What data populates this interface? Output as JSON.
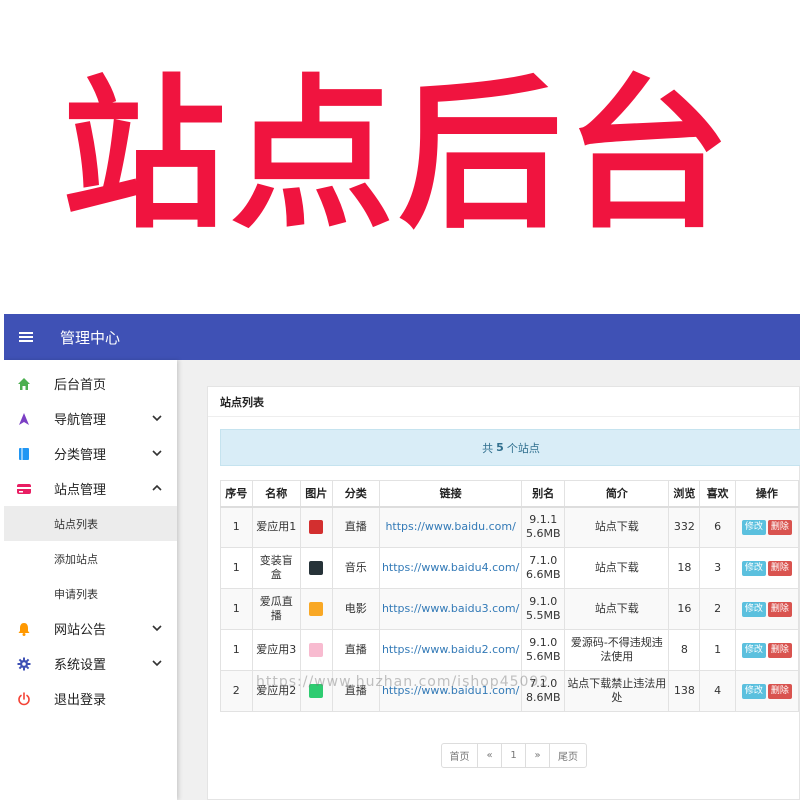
{
  "banner": {
    "title": "站点后台"
  },
  "header": {
    "title": "管理中心",
    "menu_icon": "hamburger-icon"
  },
  "sidebar": {
    "items": [
      {
        "label": "后台首页",
        "icon": "home-icon",
        "color": "#4caf50"
      },
      {
        "label": "导航管理",
        "icon": "navigation-arrow-icon",
        "color": "#7b3fc4",
        "expanded": false
      },
      {
        "label": "分类管理",
        "icon": "book-icon",
        "color": "#2196f3",
        "expanded": false
      },
      {
        "label": "站点管理",
        "icon": "credit-card-icon",
        "color": "#e91e63",
        "expanded": true,
        "children": [
          {
            "label": "站点列表",
            "active": true
          },
          {
            "label": "添加站点"
          },
          {
            "label": "申请列表"
          }
        ]
      },
      {
        "label": "网站公告",
        "icon": "bell-icon",
        "color": "#ff9800",
        "expanded": false
      },
      {
        "label": "系统设置",
        "icon": "gear-icon",
        "color": "#3f51b5",
        "expanded": false
      },
      {
        "label": "退出登录",
        "icon": "power-icon",
        "color": "#f44336"
      }
    ]
  },
  "main": {
    "card_title": "站点列表",
    "count": {
      "prefix": "共",
      "value": "5",
      "suffix": "个站点"
    },
    "columns": [
      "序号",
      "名称",
      "图片",
      "分类",
      "链接",
      "别名",
      "简介",
      "浏览",
      "喜欢",
      "操作"
    ],
    "rows": [
      {
        "id": "1",
        "name": "爱应用1",
        "thumb_color": "#d32f2f",
        "category": "直播",
        "link": "https://www.baidu.com/",
        "alias": [
          "9.1.1",
          "5.6MB"
        ],
        "intro": "站点下载",
        "views": "332",
        "likes": "6"
      },
      {
        "id": "1",
        "name": "变装盲盒",
        "thumb_color": "#263238",
        "category": "音乐",
        "link": "https://www.baidu4.com/",
        "alias": [
          "7.1.0",
          "6.6MB"
        ],
        "intro": "站点下载",
        "views": "18",
        "likes": "3"
      },
      {
        "id": "1",
        "name": "爱瓜直播",
        "thumb_color": "#f9a825",
        "category": "电影",
        "link": "https://www.baidu3.com/",
        "alias": [
          "9.1.0",
          "5.5MB"
        ],
        "intro": "站点下载",
        "views": "16",
        "likes": "2"
      },
      {
        "id": "1",
        "name": "爱应用3",
        "thumb_color": "#f8bbd0",
        "category": "直播",
        "link": "https://www.baidu2.com/",
        "alias": [
          "9.1.0",
          "5.6MB"
        ],
        "intro": "爱源码-不得违规违法使用",
        "views": "8",
        "likes": "1"
      },
      {
        "id": "2",
        "name": "爱应用2",
        "thumb_color": "#2ecc71",
        "category": "直播",
        "link": "https://www.baidu1.com/",
        "alias": [
          "7.1.0",
          "8.6MB"
        ],
        "intro": "站点下载禁止违法用处",
        "views": "138",
        "likes": "4"
      }
    ],
    "actions": {
      "edit": "修改",
      "delete": "删除"
    },
    "pagination": [
      "首页",
      "«",
      "1",
      "»",
      "尾页"
    ]
  },
  "watermark": "https://www.huzhan.com/ishop45092"
}
